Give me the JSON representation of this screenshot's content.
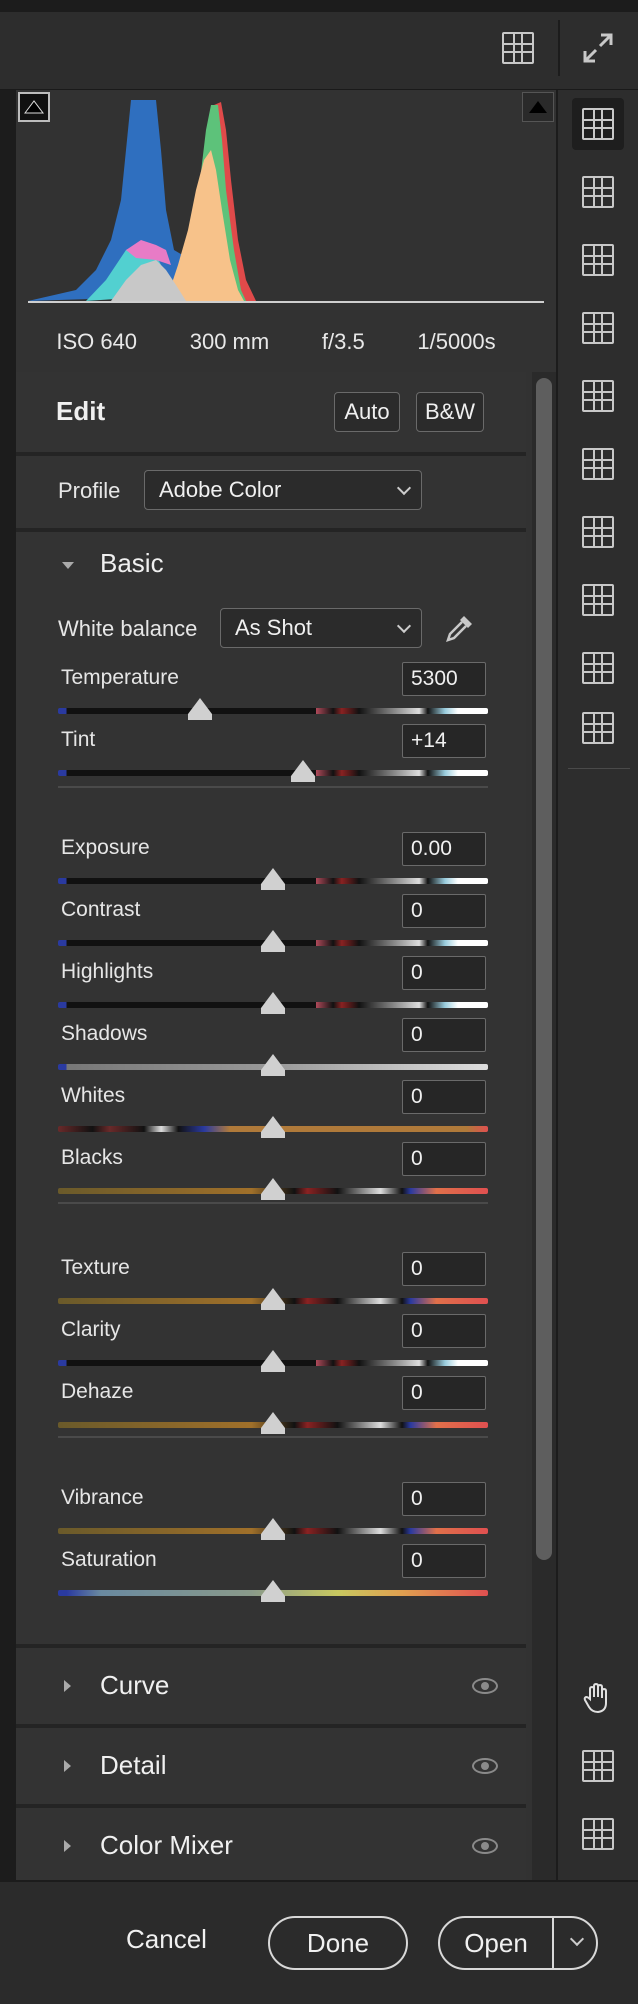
{
  "histogram": {
    "exif": [
      "ISO 640",
      "300 mm",
      "f/3.5",
      "1/5000s"
    ]
  },
  "edit": {
    "title": "Edit",
    "auto_label": "Auto",
    "bw_label": "B&W"
  },
  "profile": {
    "label": "Profile",
    "value": "Adobe Color"
  },
  "basic": {
    "title": "Basic",
    "white_balance_label": "White balance",
    "white_balance_value": "As Shot",
    "sliders": [
      {
        "name": "Temperature",
        "value": "5300",
        "level": 0.33
      },
      {
        "name": "Tint",
        "value": "+14",
        "level": 0.57
      },
      {
        "name": "Exposure",
        "value": "0.00",
        "level": 0.5
      },
      {
        "name": "Contrast",
        "value": "0",
        "level": 0.5
      },
      {
        "name": "Highlights",
        "value": "0",
        "level": 0.5
      },
      {
        "name": "Shadows",
        "value": "0",
        "level": 0.5
      },
      {
        "name": "Whites",
        "value": "0",
        "level": 0.5
      },
      {
        "name": "Blacks",
        "value": "0",
        "level": 0.5
      },
      {
        "name": "Texture",
        "value": "0",
        "level": 0.5
      },
      {
        "name": "Clarity",
        "value": "0",
        "level": 0.5
      },
      {
        "name": "Dehaze",
        "value": "0",
        "level": 0.5
      },
      {
        "name": "Vibrance",
        "value": "0",
        "level": 0.5
      },
      {
        "name": "Saturation",
        "value": "0",
        "level": 0.5
      }
    ]
  },
  "collapsed_sections": [
    "Curve",
    "Detail",
    "Color Mixer"
  ],
  "footer": {
    "cancel": "Cancel",
    "done": "Done",
    "open": "Open"
  },
  "colors": {
    "panel_bg": "#333333",
    "accent_thumb": "#d0d0d0"
  }
}
